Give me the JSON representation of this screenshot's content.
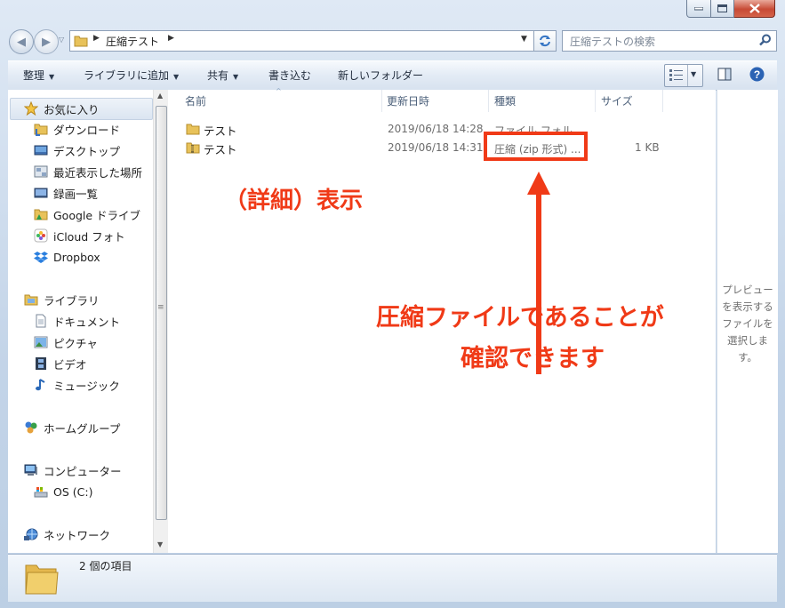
{
  "window": {
    "caption_buttons": {
      "minimize_icon": "minimize-icon",
      "maximize_icon": "maximize-icon",
      "close_icon": "close-icon"
    }
  },
  "address": {
    "segments": [
      "圧縮テスト"
    ],
    "search_placeholder": "圧縮テストの検索"
  },
  "toolbar": {
    "organize": "整理",
    "add_to_library": "ライブラリに追加",
    "share": "共有",
    "burn": "書き込む",
    "new_folder": "新しいフォルダー"
  },
  "sidebar": {
    "favorites": {
      "label": "お気に入り",
      "items": [
        {
          "label": "ダウンロード",
          "icon": "download-folder-icon"
        },
        {
          "label": "デスクトップ",
          "icon": "desktop-icon"
        },
        {
          "label": "最近表示した場所",
          "icon": "recent-places-icon"
        },
        {
          "label": "録画一覧",
          "icon": "recordings-icon"
        },
        {
          "label": "Google ドライブ",
          "icon": "google-drive-icon"
        },
        {
          "label": "iCloud フォト",
          "icon": "icloud-photos-icon"
        },
        {
          "label": "Dropbox",
          "icon": "dropbox-icon"
        }
      ]
    },
    "libraries": {
      "label": "ライブラリ",
      "items": [
        {
          "label": "ドキュメント",
          "icon": "documents-icon"
        },
        {
          "label": "ピクチャ",
          "icon": "pictures-icon"
        },
        {
          "label": "ビデオ",
          "icon": "videos-icon"
        },
        {
          "label": "ミュージック",
          "icon": "music-icon"
        }
      ]
    },
    "homegroup": {
      "label": "ホームグループ"
    },
    "computer": {
      "label": "コンピューター",
      "items": [
        {
          "label": "OS (C:)",
          "icon": "drive-icon"
        }
      ]
    },
    "network": {
      "label": "ネットワーク"
    }
  },
  "columns": {
    "name": "名前",
    "modified": "更新日時",
    "type": "種類",
    "size": "サイズ"
  },
  "files": [
    {
      "name": "テスト",
      "modified": "2019/06/18 14:28",
      "type": "ファイル フォル",
      "size": "",
      "icon": "folder-icon"
    },
    {
      "name": "テスト",
      "modified": "2019/06/18 14:31",
      "type": "圧縮 (zip 形式) ...",
      "size": "1 KB",
      "icon": "zip-folder-icon"
    }
  ],
  "preview_pane": {
    "text": "プレビューを表示するファイルを選択します。"
  },
  "status": {
    "item_count": "2 個の項目"
  },
  "annotations": {
    "view_label": "（詳細）表示",
    "callout_line1": "圧縮ファイルであることが",
    "callout_line2": "確認できます",
    "color": "#f03a17"
  }
}
